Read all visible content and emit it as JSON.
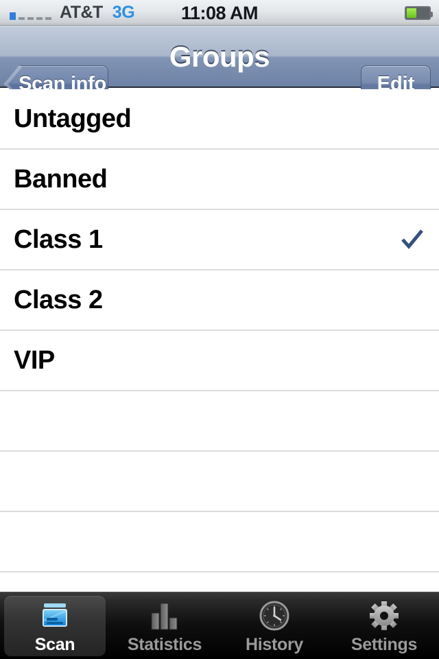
{
  "status_bar": {
    "carrier": "AT&T",
    "network_type": "3G",
    "time": "11:08 AM",
    "signal_bars_filled": 1,
    "signal_bars_total": 5,
    "battery_percent": 45,
    "battery_color": "#6fc81e"
  },
  "nav_bar": {
    "title": "Groups",
    "back_label": "Scan info",
    "edit_label": "Edit",
    "tint_color": "#7287ad"
  },
  "list": {
    "rows": [
      {
        "label": "Untagged",
        "checked": false
      },
      {
        "label": "Banned",
        "checked": false
      },
      {
        "label": "Class 1",
        "checked": true
      },
      {
        "label": "Class 2",
        "checked": false
      },
      {
        "label": "VIP",
        "checked": false
      },
      {
        "label": "",
        "checked": false
      },
      {
        "label": "",
        "checked": false
      },
      {
        "label": "",
        "checked": false
      },
      {
        "label": "",
        "checked": false
      }
    ],
    "checkmark_color": "#36517f"
  },
  "tab_bar": {
    "tabs": [
      {
        "label": "Scan",
        "icon": "scan-card-icon",
        "selected": true
      },
      {
        "label": "Statistics",
        "icon": "bar-chart-icon",
        "selected": false
      },
      {
        "label": "History",
        "icon": "clock-icon",
        "selected": false
      },
      {
        "label": "Settings",
        "icon": "gear-icon",
        "selected": false
      }
    ]
  }
}
